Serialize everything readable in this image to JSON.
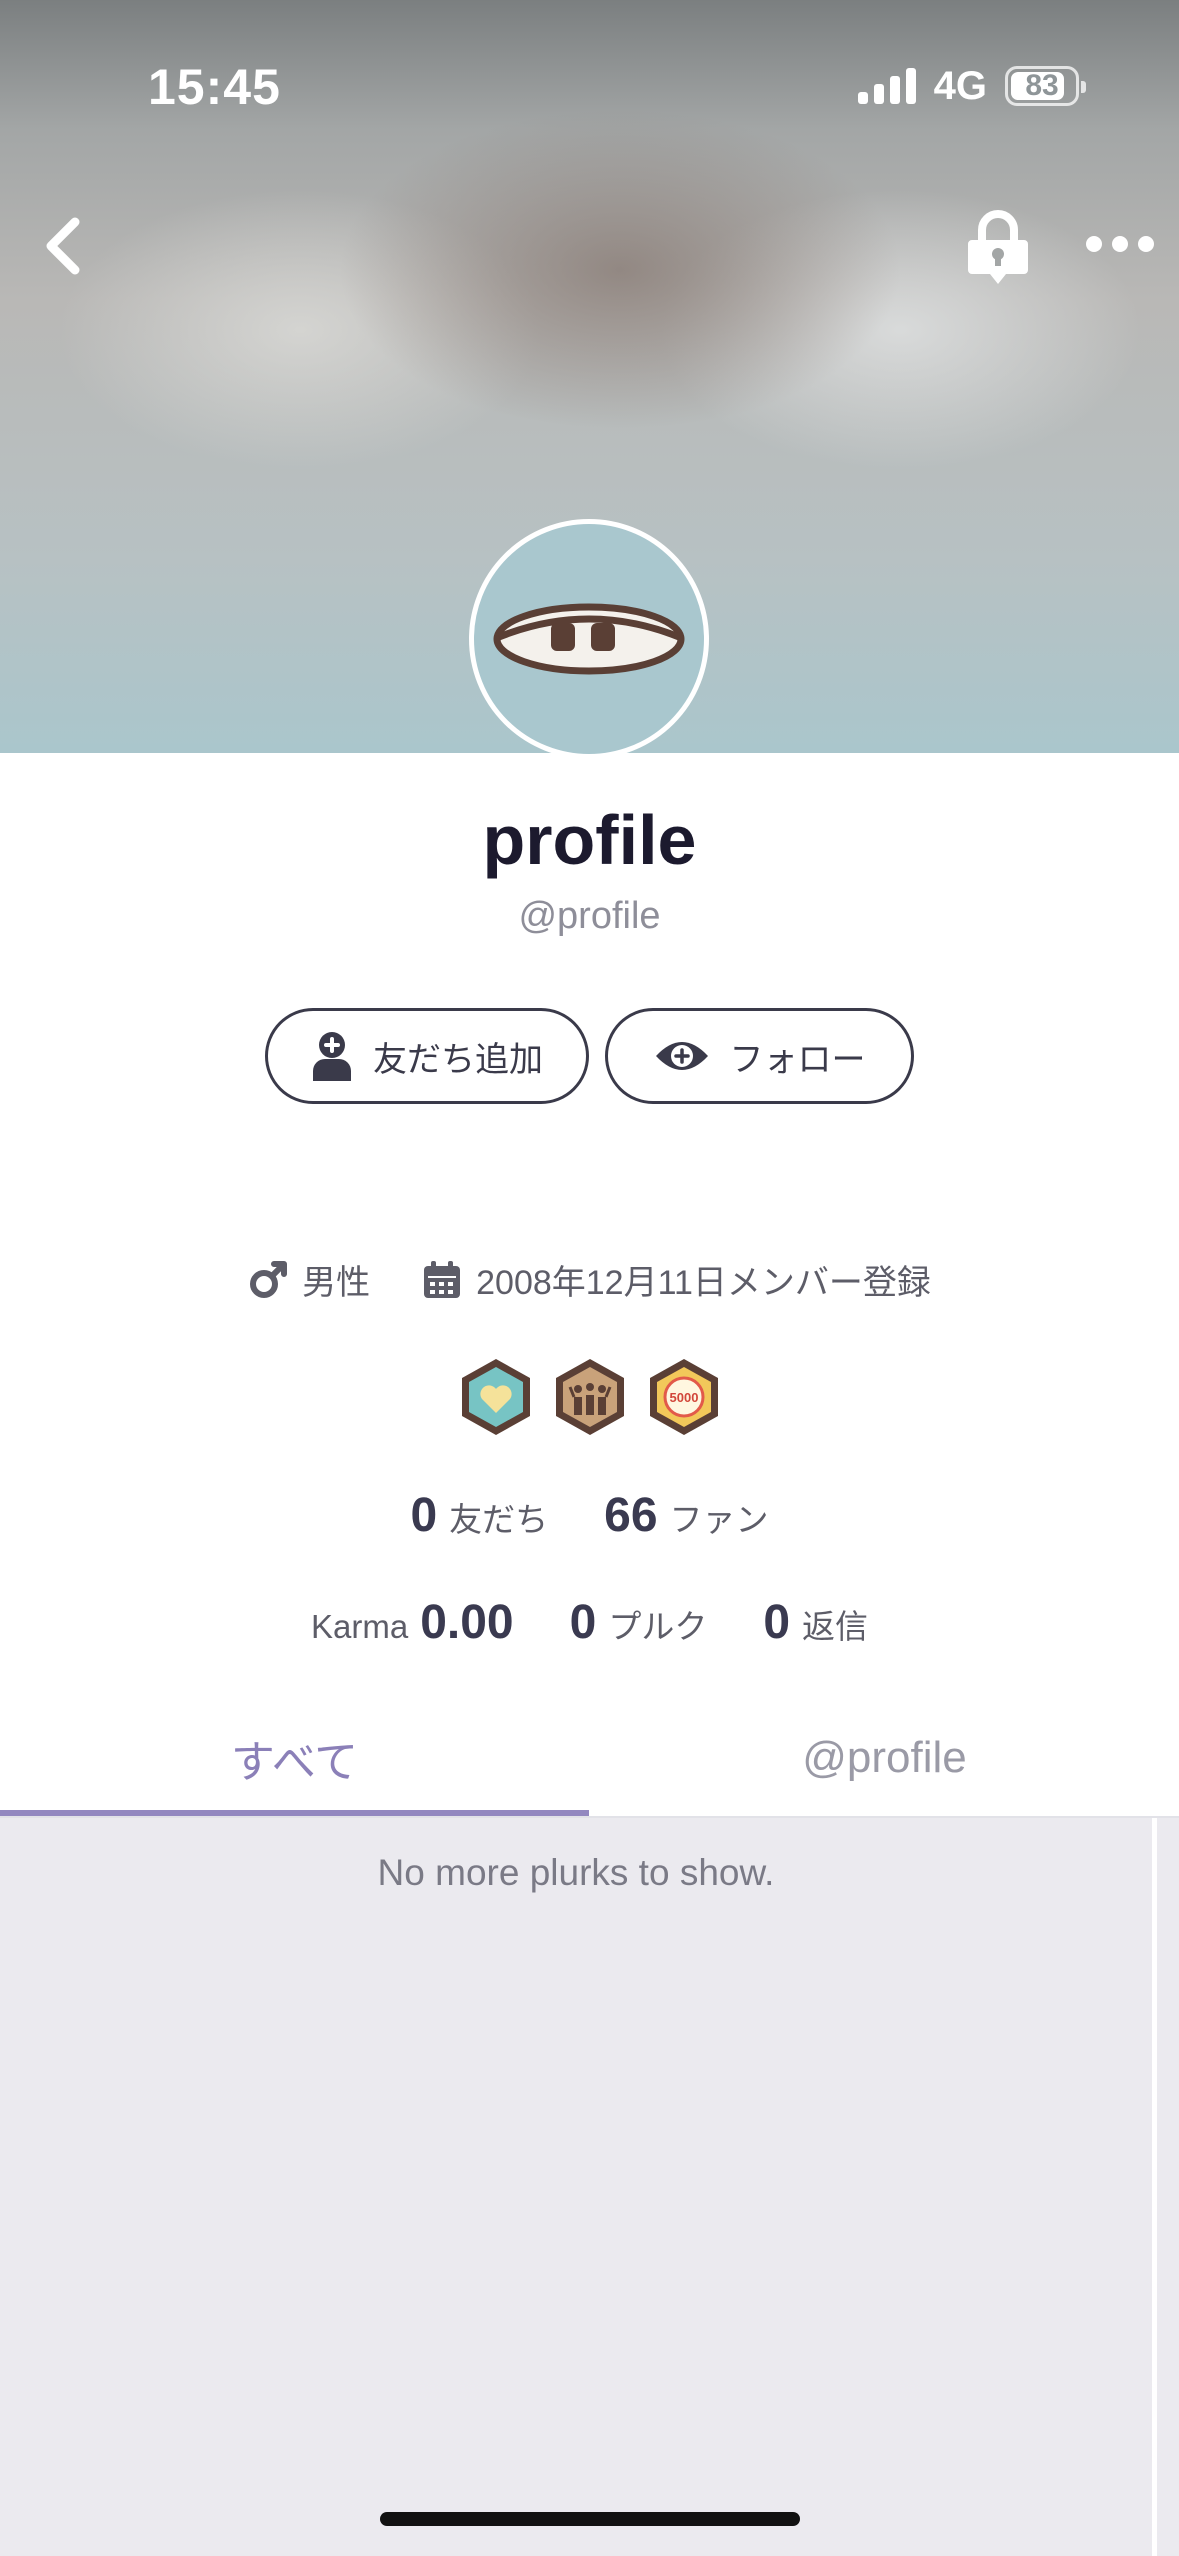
{
  "status_bar": {
    "time": "15:45",
    "network": "4G",
    "battery": "83"
  },
  "nav": {
    "back_icon": "chevron-left-icon",
    "lock_icon": "lock-icon",
    "more_icon": "more-icon"
  },
  "profile": {
    "display_name": "profile",
    "username": "@profile",
    "add_friend_label": "友だち追加",
    "follow_label": "フォロー",
    "gender": "男性",
    "joined": "2008年12月11日メンバー登録",
    "badges": [
      "heart-badge",
      "people-badge",
      "5000-badge"
    ],
    "badge_5000_text": "5000"
  },
  "stats": {
    "friends_count": "0",
    "friends_label": "友だち",
    "fans_count": "66",
    "fans_label": "ファン",
    "karma_label": "Karma",
    "karma_value": "0.00",
    "plurks_count": "0",
    "plurks_label": "プルク",
    "replies_count": "0",
    "replies_label": "返信"
  },
  "tabs": [
    {
      "label": "すべて",
      "active": true
    },
    {
      "label": "@profile",
      "active": false
    }
  ],
  "feed": {
    "empty_message": "No more plurks to show."
  },
  "colors": {
    "accent": "#9388c0",
    "text_dark": "#3a3a4a",
    "feed_bg": "#ebeaef"
  }
}
